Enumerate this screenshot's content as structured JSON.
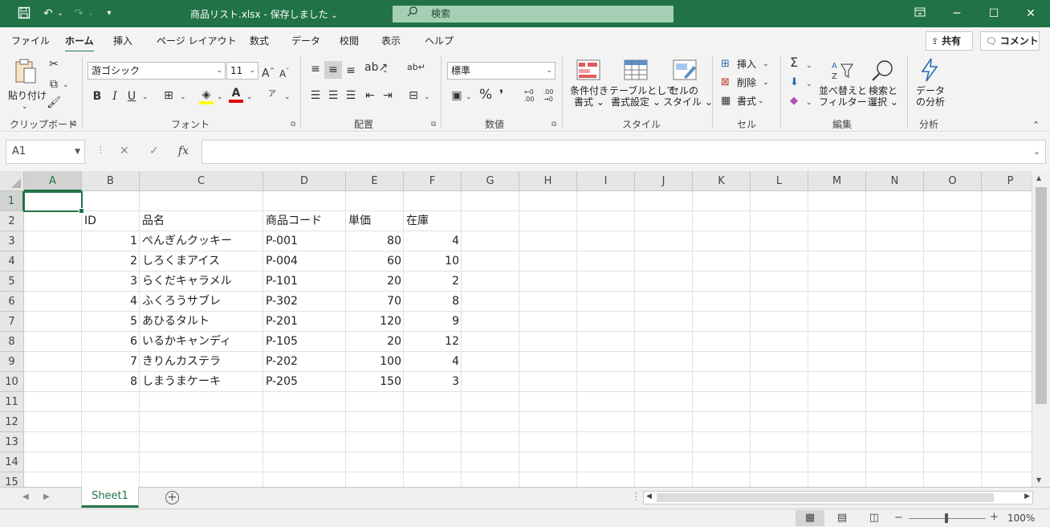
{
  "titlebar": {
    "title": "商品リスト.xlsx  -  保存しました",
    "title_arrow": "⌄",
    "search_placeholder": "検索",
    "icons": [
      "save-icon",
      "undo-icon",
      "redo-icon",
      "customize-icon",
      "ribbon-display-icon",
      "minimize-icon",
      "maximize-icon",
      "close-icon"
    ]
  },
  "tabs": [
    "ファイル",
    "ホーム",
    "挿入",
    "ページ レイアウト",
    "数式",
    "データ",
    "校閲",
    "表示",
    "ヘルプ"
  ],
  "active_tab": "ホーム",
  "share_label": "共有",
  "comment_label": "コメント",
  "ribbon": {
    "clipboard": {
      "paste": "貼り付け",
      "group": "クリップボード"
    },
    "font": {
      "name": "游ゴシック",
      "size": "11",
      "bold": "B",
      "italic": "I",
      "underline": "U",
      "grow": "A",
      "shrink": "A",
      "phonetic": "ア",
      "group": "フォント"
    },
    "alignment": {
      "group": "配置"
    },
    "number": {
      "format": "標準",
      "percent": "%",
      "comma": "❜",
      "inc": "←0 .00",
      "dec": ".00 →0",
      "group": "数値"
    },
    "styles": {
      "conditional": [
        "条件付き",
        "書式"
      ],
      "table": [
        "テーブルとして",
        "書式設定"
      ],
      "cell": [
        "セルの",
        "スタイル"
      ],
      "group": "スタイル"
    },
    "cells": {
      "insert": "挿入",
      "delete": "削除",
      "format": "書式",
      "group": "セル"
    },
    "editing": {
      "sort": [
        "並べ替えと",
        "フィルター"
      ],
      "find": [
        "検索と",
        "選択"
      ],
      "group": "編集"
    },
    "analysis": {
      "analyze": [
        "データ",
        "の分析"
      ],
      "group": "分析"
    }
  },
  "formula_bar": {
    "name_box": "A1",
    "cancel": "✕",
    "enter": "✓",
    "fx": "fx",
    "value": ""
  },
  "columns": [
    "A",
    "B",
    "C",
    "D",
    "E",
    "F",
    "G",
    "H",
    "I",
    "J",
    "K",
    "L",
    "M",
    "N",
    "O",
    "P"
  ],
  "rows": [
    "1",
    "2",
    "3",
    "4",
    "5",
    "6",
    "7",
    "8",
    "9",
    "10",
    "11",
    "12",
    "13",
    "14",
    "15"
  ],
  "sheet": {
    "headers": [
      "ID",
      "品名",
      "商品コード",
      "単価",
      "在庫"
    ],
    "records": [
      [
        "1",
        "ぺんぎんクッキー",
        "P-001",
        "80",
        "4"
      ],
      [
        "2",
        "しろくまアイス",
        "P-004",
        "60",
        "10"
      ],
      [
        "3",
        "らくだキャラメル",
        "P-101",
        "20",
        "2"
      ],
      [
        "4",
        "ふくろうサブレ",
        "P-302",
        "70",
        "8"
      ],
      [
        "5",
        "あひるタルト",
        "P-201",
        "120",
        "9"
      ],
      [
        "6",
        "いるかキャンディ",
        "P-105",
        "20",
        "12"
      ],
      [
        "7",
        "きりんカステラ",
        "P-202",
        "100",
        "4"
      ],
      [
        "8",
        "しまうまケーキ",
        "P-205",
        "150",
        "3"
      ]
    ]
  },
  "sheet_tabs": [
    "Sheet1"
  ],
  "status": {
    "zoom": "100%",
    "minus": "−",
    "plus": "+"
  },
  "colors": {
    "accent": "#217346",
    "search": "#a5cfb4"
  }
}
